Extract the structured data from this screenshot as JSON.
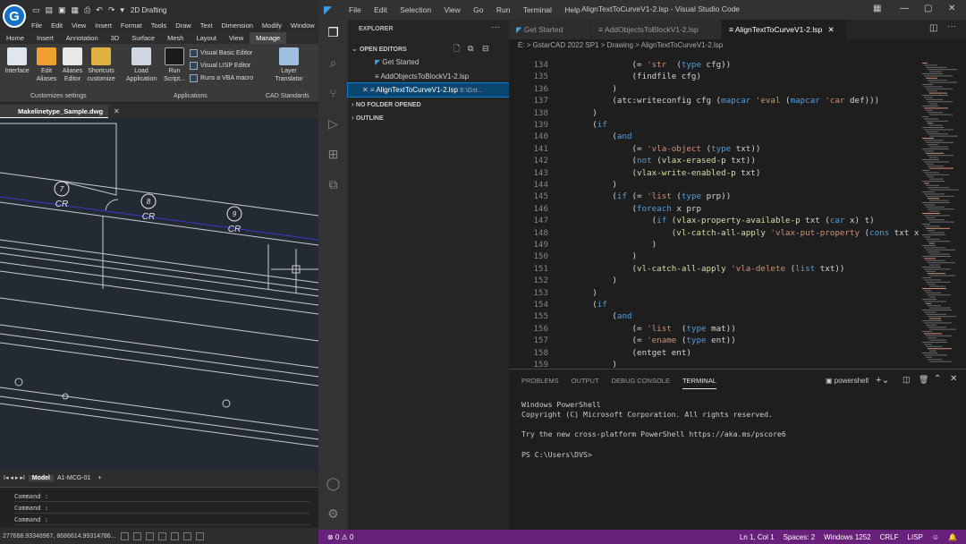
{
  "cad": {
    "workspace": "2D Drafting",
    "menus": [
      "File",
      "Edit",
      "View",
      "Insert",
      "Format",
      "Tools",
      "Draw",
      "Text",
      "Dimension",
      "Modify",
      "Window"
    ],
    "tabs": [
      "Home",
      "Insert",
      "Annotation",
      "3D",
      "Surface",
      "Mesh",
      "Layout",
      "View",
      "Manage"
    ],
    "active_tab": "Manage",
    "ribbon": {
      "buttons": [
        "Interface",
        "Edit Aliases",
        "Aliases Editor",
        "Shortcuts customize",
        "Load Application",
        "Run Script...",
        "Layer Translator"
      ],
      "small": [
        "Visual Basic Editor",
        "Visual LISP Editor",
        "Runs a VBA macro"
      ],
      "groups": [
        "Customizes settings",
        "Applications",
        "CAD Standards"
      ]
    },
    "doc_tab": "Makelinetype_Sample.dwg",
    "markers": [
      {
        "num": "7",
        "label": "CR"
      },
      {
        "num": "8",
        "label": "CR"
      },
      {
        "num": "9",
        "label": "CR"
      }
    ],
    "layout_tabs": [
      "Model",
      "A1-MCG-01"
    ],
    "cmd_prompt": "Command :",
    "coords": "277668.93348967, 8686614.99314786..."
  },
  "vscode": {
    "menus": [
      "File",
      "Edit",
      "Selection",
      "View",
      "Go",
      "Run",
      "Terminal",
      "Help"
    ],
    "window_title": "AlignTextToCurveV1-2.lsp - Visual Studio Code",
    "explorer": {
      "header": "EXPLORER",
      "open_editors": "OPEN EDITORS",
      "items": [
        "Get Started",
        "AddObjectsToBlockV1-2.lsp",
        "AlignTextToCurveV1-2.lsp"
      ],
      "path_hint": "E:\\Gst...",
      "no_folder": "NO FOLDER OPENED",
      "outline": "OUTLINE"
    },
    "tabs": [
      "Get Started",
      "AddObjectsToBlockV1-2.lsp",
      "AlignTextToCurveV1-2.lsp"
    ],
    "breadcrumb": "E: > GstarCAD 2022 SP1 > Drawing > AlignTextToCurveV1-2.lsp",
    "code": [
      {
        "n": "134",
        "t": "                (= 'str  (type cfg))"
      },
      {
        "n": "135",
        "t": "                (findfile cfg)"
      },
      {
        "n": "136",
        "t": "            )"
      },
      {
        "n": "137",
        "t": "            (atc:writeconfig cfg (mapcar 'eval (mapcar 'car def)))"
      },
      {
        "n": "138",
        "t": "        )"
      },
      {
        "n": "139",
        "t": "        (if"
      },
      {
        "n": "140",
        "t": "            (and"
      },
      {
        "n": "141",
        "t": "                (= 'vla-object (type txt))"
      },
      {
        "n": "142",
        "t": "                (not (vlax-erased-p txt))"
      },
      {
        "n": "143",
        "t": "                (vlax-write-enabled-p txt)"
      },
      {
        "n": "144",
        "t": "            )"
      },
      {
        "n": "145",
        "t": "            (if (= 'list (type prp))"
      },
      {
        "n": "146",
        "t": "                (foreach x prp"
      },
      {
        "n": "147",
        "t": "                    (if (vlax-property-available-p txt (car x) t)"
      },
      {
        "n": "148",
        "t": "                        (vl-catch-all-apply 'vlax-put-property (cons txt x))"
      },
      {
        "n": "149",
        "t": "                    )"
      },
      {
        "n": "150",
        "t": "                )"
      },
      {
        "n": "151",
        "t": "                (vl-catch-all-apply 'vla-delete (list txt))"
      },
      {
        "n": "152",
        "t": "            )"
      },
      {
        "n": "153",
        "t": "        )"
      },
      {
        "n": "154",
        "t": "        (if"
      },
      {
        "n": "155",
        "t": "            (and"
      },
      {
        "n": "156",
        "t": "                (= 'list  (type mat))"
      },
      {
        "n": "157",
        "t": "                (= 'ename (type ent))"
      },
      {
        "n": "158",
        "t": "                (entget ent)"
      },
      {
        "n": "159",
        "t": "            )"
      }
    ],
    "panel_tabs": [
      "PROBLEMS",
      "OUTPUT",
      "DEBUG CONSOLE",
      "TERMINAL"
    ],
    "active_panel_tab": "TERMINAL",
    "terminal_name": "powershell",
    "terminal": [
      "Windows PowerShell",
      "Copyright (C) Microsoft Corporation. All rights reserved.",
      "",
      "Try the new cross-platform PowerShell https://aka.ms/pscore6",
      "",
      "PS C:\\Users\\DVS>"
    ],
    "status": {
      "errors": "⊗ 0 ⚠ 0",
      "position": "Ln 1, Col 1",
      "spaces": "Spaces: 2",
      "encoding": "Windows 1252",
      "eol": "CRLF",
      "lang": "LISP"
    },
    "colors": {
      "status_bar": "#68217a",
      "selection": "#094771"
    }
  }
}
